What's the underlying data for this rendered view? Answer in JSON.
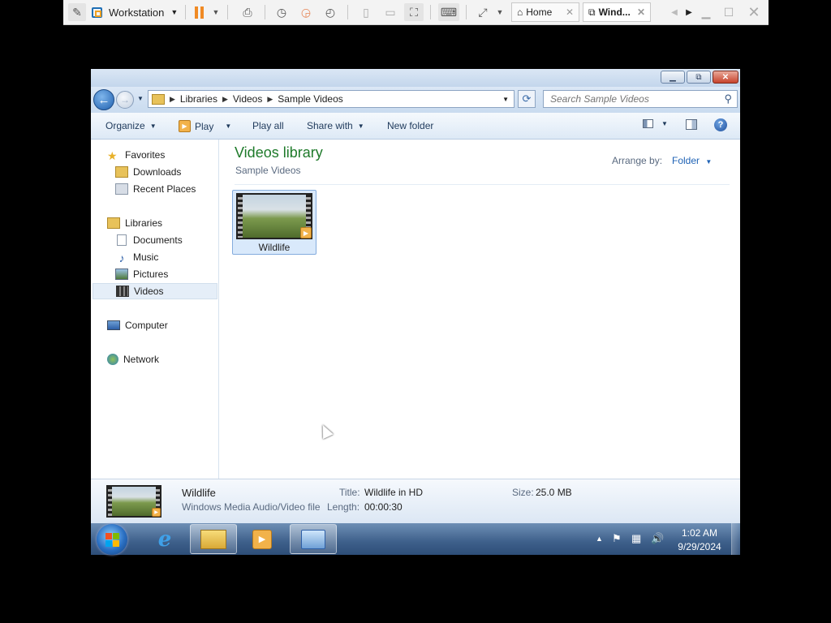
{
  "vmware": {
    "workstation_label": "Workstation",
    "tabs": [
      {
        "label": "Home"
      },
      {
        "label": "Wind..."
      }
    ]
  },
  "explorer": {
    "breadcrumb": [
      "Libraries",
      "Videos",
      "Sample Videos"
    ],
    "search_placeholder": "Search Sample Videos",
    "commands": {
      "organize": "Organize",
      "play": "Play",
      "play_all": "Play all",
      "share_with": "Share with",
      "new_folder": "New folder"
    },
    "nav": {
      "favorites": "Favorites",
      "downloads": "Downloads",
      "recent_places": "Recent Places",
      "libraries": "Libraries",
      "documents": "Documents",
      "music": "Music",
      "pictures": "Pictures",
      "videos": "Videos",
      "computer": "Computer",
      "network": "Network"
    },
    "library_title": "Videos library",
    "library_subtitle": "Sample Videos",
    "arrange_label": "Arrange by:",
    "arrange_value": "Folder",
    "files": [
      {
        "name": "Wildlife"
      }
    ],
    "details": {
      "name": "Wildlife",
      "type": "Windows Media Audio/Video file",
      "title_label": "Title:",
      "title_value": "Wildlife in HD",
      "length_label": "Length:",
      "length_value": "00:00:30",
      "size_label": "Size:",
      "size_value": "25.0 MB"
    }
  },
  "taskbar": {
    "time": "1:02 AM",
    "date": "9/29/2024"
  },
  "colors": {
    "library_title": "#1e7a2a",
    "link_blue": "#1e62b5",
    "taskbar": "#3d5f8a"
  }
}
